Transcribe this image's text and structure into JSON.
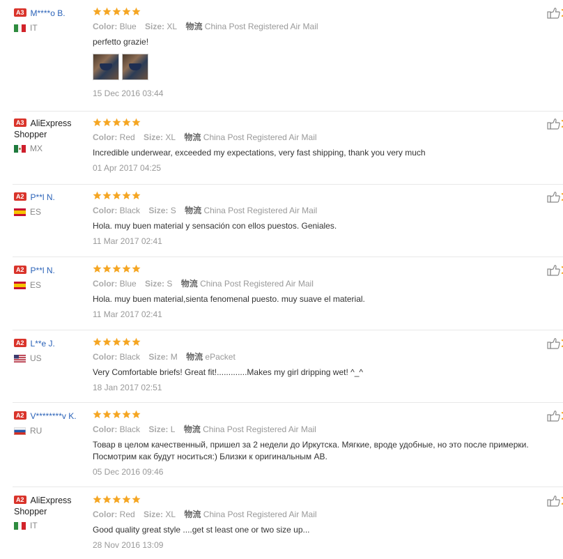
{
  "labels": {
    "color": "Color:",
    "size": "Size:",
    "logistics": "物流"
  },
  "colors": {
    "accent_link": "#2a62b8",
    "star": "#f5a623",
    "badge": "#d9342b"
  },
  "reviews": [
    {
      "badge": "A3",
      "user": "M****o B.",
      "country_code": "IT",
      "flag": "italy-flag",
      "rating": 5,
      "color": "Blue",
      "size": "XL",
      "shipping": "China Post Registered Air Mail",
      "text": "perfetto grazie!",
      "photos": [
        "photo-1",
        "photo-2"
      ],
      "date": "15 Dec 2016 03:44"
    },
    {
      "badge": "A3",
      "user": "AliExpress Shopper",
      "country_code": "MX",
      "flag": "mexico-flag",
      "rating": 5,
      "color": "Red",
      "size": "XL",
      "shipping": "China Post Registered Air Mail",
      "text": "Incredible underwear, exceeded my expectations, very fast shipping, thank you very much",
      "date": "01 Apr 2017 04:25"
    },
    {
      "badge": "A2",
      "user": "P**l N.",
      "country_code": "ES",
      "flag": "spain-flag",
      "rating": 5,
      "color": "Black",
      "size": "S",
      "shipping": "China Post Registered Air Mail",
      "text": "Hola. muy buen material y sensación con ellos puestos. Geniales.",
      "date": "11 Mar 2017 02:41"
    },
    {
      "badge": "A2",
      "user": "P**l N.",
      "country_code": "ES",
      "flag": "spain-flag",
      "rating": 5,
      "color": "Blue",
      "size": "S",
      "shipping": "China Post Registered Air Mail",
      "text": "Hola. muy buen material,sienta fenomenal puesto. muy suave el material.",
      "date": "11 Mar 2017 02:41"
    },
    {
      "badge": "A2",
      "user": "L**e J.",
      "country_code": "US",
      "flag": "usa-flag",
      "rating": 5,
      "color": "Black",
      "size": "M",
      "shipping": "ePacket",
      "text": "Very Comfortable briefs! Great fit!.............Makes my girl dripping wet! ^_^",
      "date": "18 Jan 2017 02:51"
    },
    {
      "badge": "A2",
      "user": "V********v K.",
      "country_code": "RU",
      "flag": "russia-flag",
      "rating": 5,
      "color": "Black",
      "size": "L",
      "shipping": "China Post Registered Air Mail",
      "text": "Товар в целом качественный, пришел за 2 недели до Иркутска. Мягкие, вроде удобные, но это после примерки. Посмотрим как будут носиться:) Близки к оригинальным АВ.",
      "date": "05 Dec 2016 09:46"
    },
    {
      "badge": "A2",
      "user": "AliExpress Shopper",
      "country_code": "IT",
      "flag": "italy-flag",
      "rating": 5,
      "color": "Red",
      "size": "XL",
      "shipping": "China Post Registered Air Mail",
      "text": "Good quality great style ....get st least one or two size up...",
      "date": "28 Nov 2016 13:09"
    }
  ]
}
